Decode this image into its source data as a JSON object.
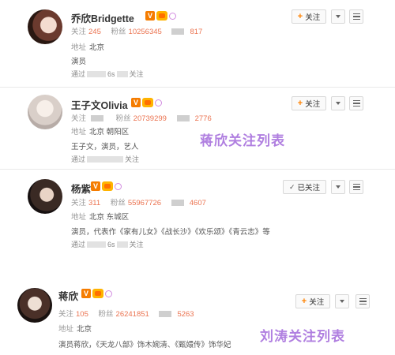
{
  "labels": {
    "follow": "关注",
    "fans": "粉丝",
    "location": "地址",
    "via_prefix": "通过",
    "via_suffix": "关注",
    "follow_btn": "关注",
    "followed_btn": "已关注"
  },
  "users": [
    {
      "name": "乔欣Bridgette",
      "following": "245",
      "fans": "10256345",
      "weibo": "817",
      "location": "北京",
      "bio": "演员",
      "via_middle": "6s",
      "followed": false
    },
    {
      "name": "王子文Olivia",
      "following": "",
      "fans": "20739299",
      "weibo": "2776",
      "location": "北京 朝阳区",
      "bio": "王子文，演员，艺人",
      "via_middle": "",
      "followed": false
    },
    {
      "name": "杨紫",
      "following": "311",
      "fans": "55967726",
      "weibo": "4607",
      "location": "北京 东城区",
      "bio": "演员，代表作《家有儿女》《战长沙》《欢乐颂》《青云志》等",
      "via_middle": "6s",
      "followed": true
    },
    {
      "name": "蒋欣",
      "following": "105",
      "fans": "26241851",
      "weibo": "5263",
      "location": "北京",
      "bio": "演员蒋欣，《天龙八部》饰木婉清、《甄嬛传》饰华妃",
      "via_middle": "",
      "followed": false
    }
  ],
  "overlays": {
    "jiangxin_list": "蒋欣关注列表",
    "liutao_list": "刘涛关注列表"
  }
}
